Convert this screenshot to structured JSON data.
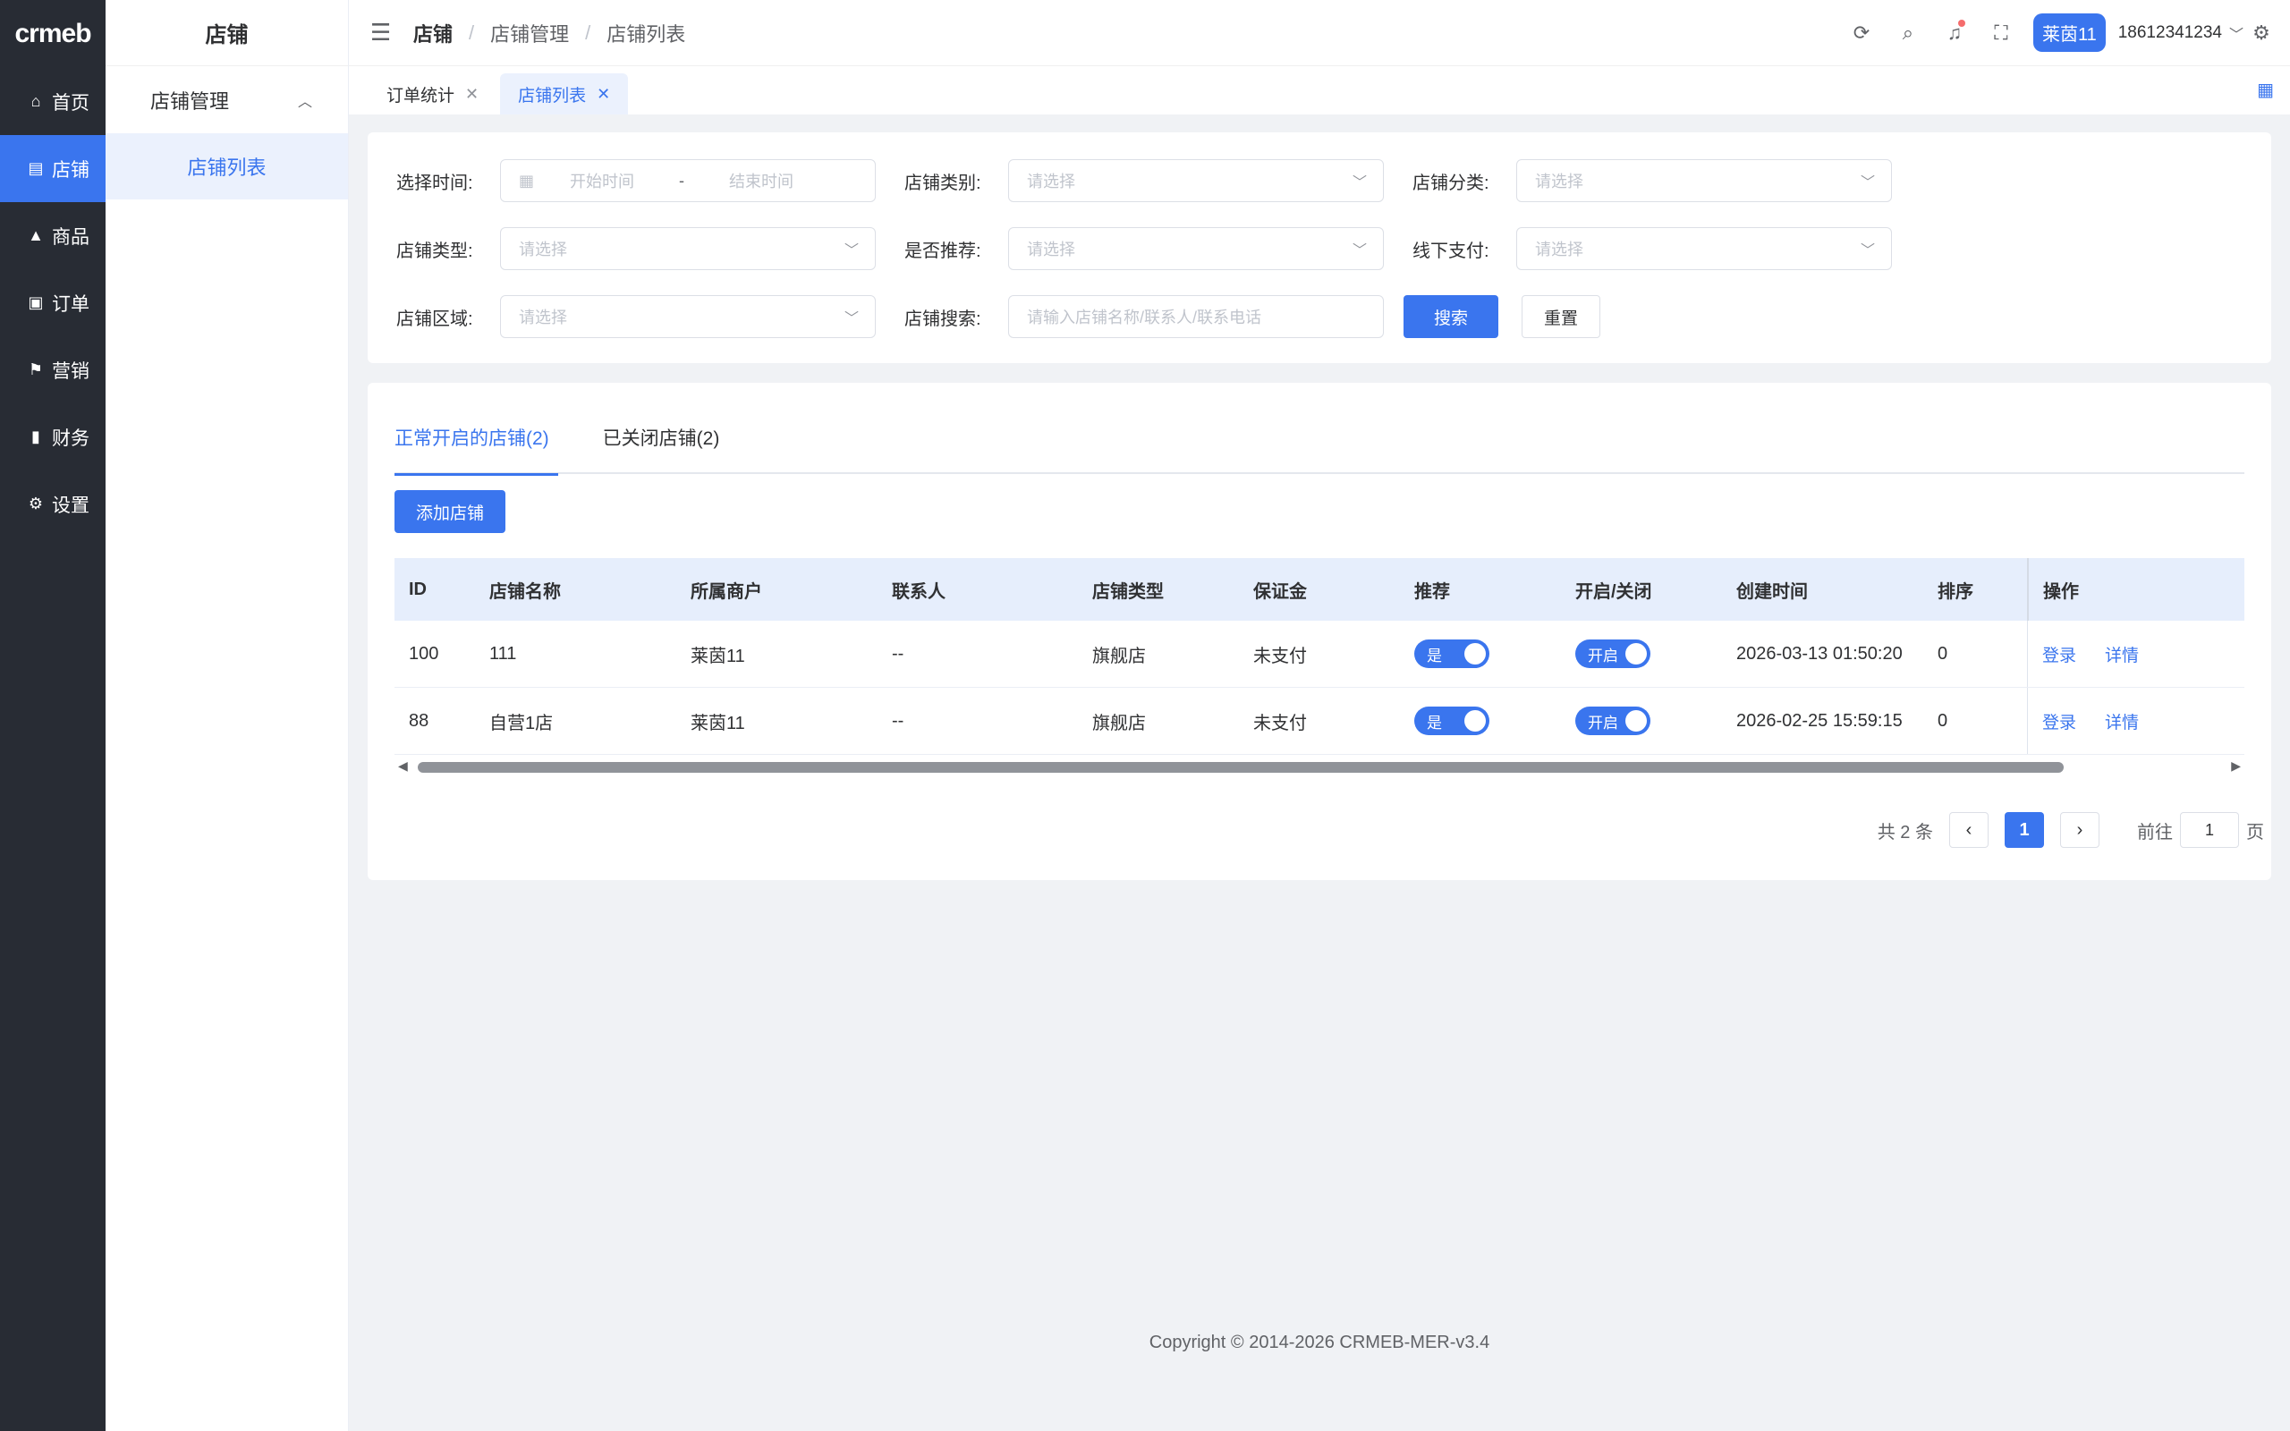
{
  "logo": "crmeb",
  "rail": [
    {
      "icon": "home-icon",
      "glyph": "⌂",
      "label": "首页"
    },
    {
      "icon": "store-icon",
      "glyph": "▤",
      "label": "店铺",
      "active": true
    },
    {
      "icon": "bag-icon",
      "glyph": "▲",
      "label": "商品"
    },
    {
      "icon": "clipboard-icon",
      "glyph": "▣",
      "label": "订单"
    },
    {
      "icon": "flag-icon",
      "glyph": "⚑",
      "label": "营销"
    },
    {
      "icon": "bar-chart-icon",
      "glyph": "▮",
      "label": "财务"
    },
    {
      "icon": "gear-icon",
      "glyph": "⚙",
      "label": "设置"
    }
  ],
  "submenu": {
    "title": "店铺",
    "group": "店铺管理",
    "item": "店铺列表"
  },
  "header": {
    "breadcrumb": [
      "店铺",
      "店铺管理",
      "店铺列表"
    ],
    "user_name": "莱茵11",
    "user_phone": "18612341234"
  },
  "visited_tabs": [
    {
      "label": "订单统计",
      "active": false
    },
    {
      "label": "店铺列表",
      "active": true
    }
  ],
  "filters": {
    "time_label": "选择时间:",
    "start_placeholder": "开始时间",
    "end_placeholder": "结束时间",
    "date_sep": "-",
    "category_label": "店铺类别:",
    "classify_label": "店铺分类:",
    "type_label": "店铺类型:",
    "recommend_label": "是否推荐:",
    "offline_pay_label": "线下支付:",
    "region_label": "店铺区域:",
    "search_label": "店铺搜索:",
    "select_placeholder": "请选择",
    "search_placeholder": "请输入店铺名称/联系人/联系电话",
    "search_button": "搜索",
    "reset_button": "重置"
  },
  "status_tabs": [
    {
      "label": "正常开启的店铺(2)",
      "active": true
    },
    {
      "label": "已关闭店铺(2)",
      "active": false
    }
  ],
  "add_button": "添加店铺",
  "table": {
    "columns": [
      "ID",
      "店铺名称",
      "所属商户",
      "联系人",
      "店铺类型",
      "保证金",
      "推荐",
      "开启/关闭",
      "创建时间",
      "排序",
      "操作"
    ],
    "rows": [
      {
        "id": "100",
        "name": "111",
        "merchant": "莱茵11",
        "contact": "--",
        "type": "旗舰店",
        "deposit": "未支付",
        "recommend": "是",
        "open": "开启",
        "created": "2026-03-13 01:50:20",
        "sort": "0",
        "login": "登录",
        "detail": "详情"
      },
      {
        "id": "88",
        "name": "自营1店",
        "merchant": "莱茵11",
        "contact": "--",
        "type": "旗舰店",
        "deposit": "未支付",
        "recommend": "是",
        "open": "开启",
        "created": "2026-02-25 15:59:15",
        "sort": "0",
        "login": "登录",
        "detail": "详情"
      }
    ]
  },
  "pagination": {
    "total": "共 2 条",
    "current": "1",
    "goto_label": "前往",
    "goto_value": "1",
    "page_suffix": "页"
  },
  "footer": "Copyright © 2014-2026 CRMEB-MER-v3.4"
}
